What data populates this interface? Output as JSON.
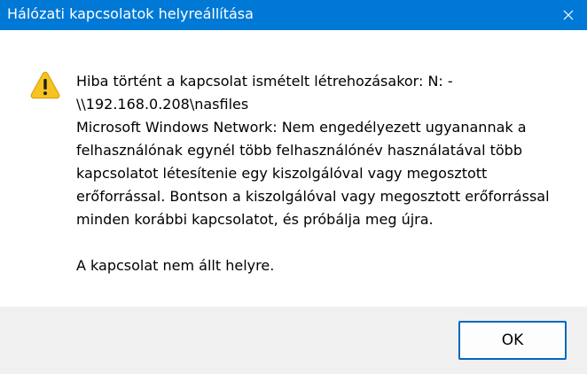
{
  "window": {
    "title": "Hálózati kapcsolatok helyreállítása",
    "close_icon": "close-icon",
    "titlebar_color": "#0079d6"
  },
  "message": {
    "icon": "warning-icon",
    "lines": [
      "Hiba történt a kapcsolat ismételt létrehozásakor: N: -",
      "\\\\192.168.0.208\\nasfiles",
      "Microsoft Windows Network: Nem engedélyezett ugyanannak a",
      "felhasználónak egynél több felhasználónév használatával több",
      "kapcsolatot létesítenie egy kiszolgálóval vagy megosztott",
      "erőforrással. Bontson a kiszolgálóval vagy megosztott erőforrással",
      "minden korábbi kapcsolatot, és próbálja meg újra."
    ],
    "footer_line": "A kapcsolat nem állt helyre."
  },
  "buttons": {
    "ok_label": "OK"
  }
}
